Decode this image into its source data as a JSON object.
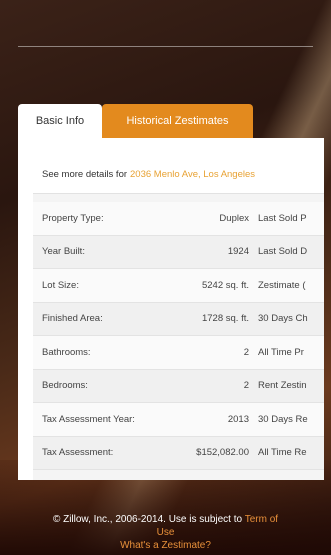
{
  "tabs": [
    {
      "label": "Basic Info"
    },
    {
      "label": "Historical Zestimates"
    }
  ],
  "details": {
    "prefix": "See more details for",
    "address": "2036 Menlo Ave, Los Angeles"
  },
  "rows": [
    {
      "label": "Property Type:",
      "value": "Duplex",
      "right": "Last Sold P"
    },
    {
      "label": "Year Built:",
      "value": "1924",
      "right": "Last Sold D"
    },
    {
      "label": "Lot Size:",
      "value": "5242 sq. ft.",
      "right": "Zestimate ("
    },
    {
      "label": "Finished Area:",
      "value": "1728 sq. ft.",
      "right": "30 Days Ch"
    },
    {
      "label": "Bathrooms:",
      "value": "2",
      "right": "All Time Pr"
    },
    {
      "label": "Bedrooms:",
      "value": "2",
      "right": "Rent Zestin"
    },
    {
      "label": "Tax Assessment Year:",
      "value": "2013",
      "right": "30 Days Re"
    },
    {
      "label": "Tax Assessment:",
      "value": "$152,082.00",
      "right": "All Time Re"
    }
  ],
  "footer": {
    "copyright": "© Zillow, Inc., 2006-2014. Use is subject to",
    "terms_link": "Term of",
    "terms_link_2": "Use",
    "zestimate_link": "What's a Zestimate?"
  },
  "colors": {
    "accent_orange": "#e38a1e",
    "link_orange": "#e8a233"
  }
}
